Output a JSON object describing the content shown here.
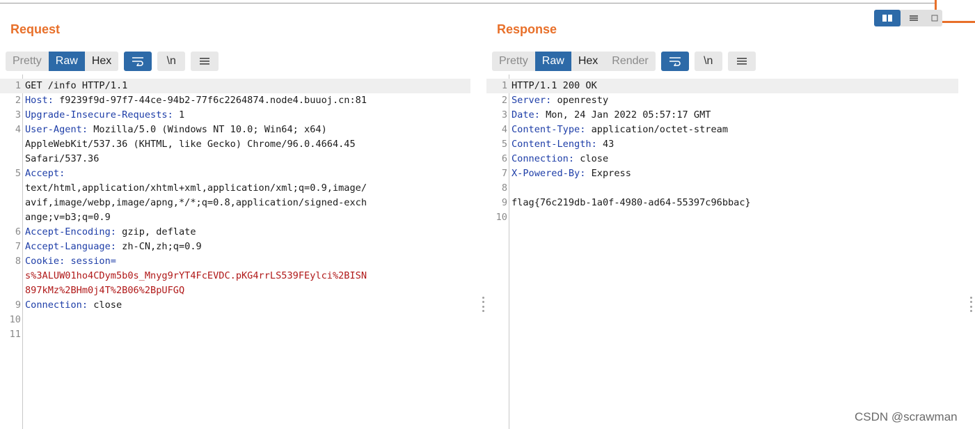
{
  "request": {
    "title": "Request",
    "tabs": [
      "Pretty",
      "Raw",
      "Hex"
    ],
    "active_tab": "Raw",
    "newline_label": "\\n",
    "lines": [
      {
        "n": "1",
        "parts": [
          {
            "t": "GET /info HTTP/1.1",
            "c": "v"
          }
        ]
      },
      {
        "n": "2",
        "parts": [
          {
            "t": "Host:",
            "c": "k"
          },
          {
            "t": " f9239f9d-97f7-44ce-94b2-77f6c2264874.node4.buuoj.cn:81",
            "c": "v"
          }
        ]
      },
      {
        "n": "3",
        "parts": [
          {
            "t": "Upgrade-Insecure-Requests:",
            "c": "k"
          },
          {
            "t": " 1",
            "c": "v"
          }
        ]
      },
      {
        "n": "4",
        "parts": [
          {
            "t": "User-Agent:",
            "c": "k"
          },
          {
            "t": " Mozilla/5.0 (Windows NT 10.0; Win64; x64)",
            "c": "v"
          }
        ]
      },
      {
        "n": "",
        "parts": [
          {
            "t": "AppleWebKit/537.36 (KHTML, like Gecko) Chrome/96.0.4664.45",
            "c": "v"
          }
        ]
      },
      {
        "n": "",
        "parts": [
          {
            "t": "Safari/537.36",
            "c": "v"
          }
        ]
      },
      {
        "n": "5",
        "parts": [
          {
            "t": "Accept:",
            "c": "k"
          }
        ]
      },
      {
        "n": "",
        "parts": [
          {
            "t": "text/html,application/xhtml+xml,application/xml;q=0.9,image/",
            "c": "v"
          }
        ]
      },
      {
        "n": "",
        "parts": [
          {
            "t": "avif,image/webp,image/apng,*/*;q=0.8,application/signed-exch",
            "c": "v"
          }
        ]
      },
      {
        "n": "",
        "parts": [
          {
            "t": "ange;v=b3;q=0.9",
            "c": "v"
          }
        ]
      },
      {
        "n": "6",
        "parts": [
          {
            "t": "Accept-Encoding:",
            "c": "k"
          },
          {
            "t": " gzip, deflate",
            "c": "v"
          }
        ]
      },
      {
        "n": "7",
        "parts": [
          {
            "t": "Accept-Language:",
            "c": "k"
          },
          {
            "t": " zh-CN,zh;q=0.9",
            "c": "v"
          }
        ]
      },
      {
        "n": "8",
        "parts": [
          {
            "t": "Cookie:",
            "c": "k"
          },
          {
            "t": " session=",
            "c": "k"
          }
        ]
      },
      {
        "n": "",
        "parts": [
          {
            "t": "s%3ALUW01ho4CDym5b0s_Mnyg9rYT4FcEVDC.pKG4rrLS539FEylci%2BISN",
            "c": "r"
          }
        ]
      },
      {
        "n": "",
        "parts": [
          {
            "t": "897kMz%2BHm0j4T%2B06%2BpUFGQ",
            "c": "r"
          }
        ]
      },
      {
        "n": "9",
        "parts": [
          {
            "t": "Connection:",
            "c": "k"
          },
          {
            "t": " close",
            "c": "v"
          }
        ]
      },
      {
        "n": "10",
        "parts": []
      },
      {
        "n": "11",
        "parts": []
      }
    ]
  },
  "response": {
    "title": "Response",
    "tabs": [
      "Pretty",
      "Raw",
      "Hex",
      "Render"
    ],
    "active_tab": "Raw",
    "newline_label": "\\n",
    "lines": [
      {
        "n": "1",
        "parts": [
          {
            "t": "HTTP/1.1 200 OK",
            "c": "v"
          }
        ]
      },
      {
        "n": "2",
        "parts": [
          {
            "t": "Server:",
            "c": "k"
          },
          {
            "t": " openresty",
            "c": "v"
          }
        ]
      },
      {
        "n": "3",
        "parts": [
          {
            "t": "Date:",
            "c": "k"
          },
          {
            "t": " Mon, 24 Jan 2022 05:57:17 GMT",
            "c": "v"
          }
        ]
      },
      {
        "n": "4",
        "parts": [
          {
            "t": "Content-Type:",
            "c": "k"
          },
          {
            "t": " application/octet-stream",
            "c": "v"
          }
        ]
      },
      {
        "n": "5",
        "parts": [
          {
            "t": "Content-Length:",
            "c": "k"
          },
          {
            "t": " 43",
            "c": "v"
          }
        ]
      },
      {
        "n": "6",
        "parts": [
          {
            "t": "Connection:",
            "c": "k"
          },
          {
            "t": " close",
            "c": "v"
          }
        ]
      },
      {
        "n": "7",
        "parts": [
          {
            "t": "X-Powered-By:",
            "c": "k"
          },
          {
            "t": " Express",
            "c": "v"
          }
        ]
      },
      {
        "n": "8",
        "parts": []
      },
      {
        "n": "9",
        "parts": [
          {
            "t": "flag{76c219db-1a0f-4980-ad64-55397c96bbac}",
            "c": "v"
          }
        ]
      },
      {
        "n": "10",
        "parts": []
      }
    ]
  },
  "watermark": "CSDN @scrawman",
  "colors": {
    "accent_orange": "#e8702a",
    "active_blue": "#2d6aa8",
    "header_key_blue": "#1e3ea8",
    "cookie_red": "#b01818"
  }
}
